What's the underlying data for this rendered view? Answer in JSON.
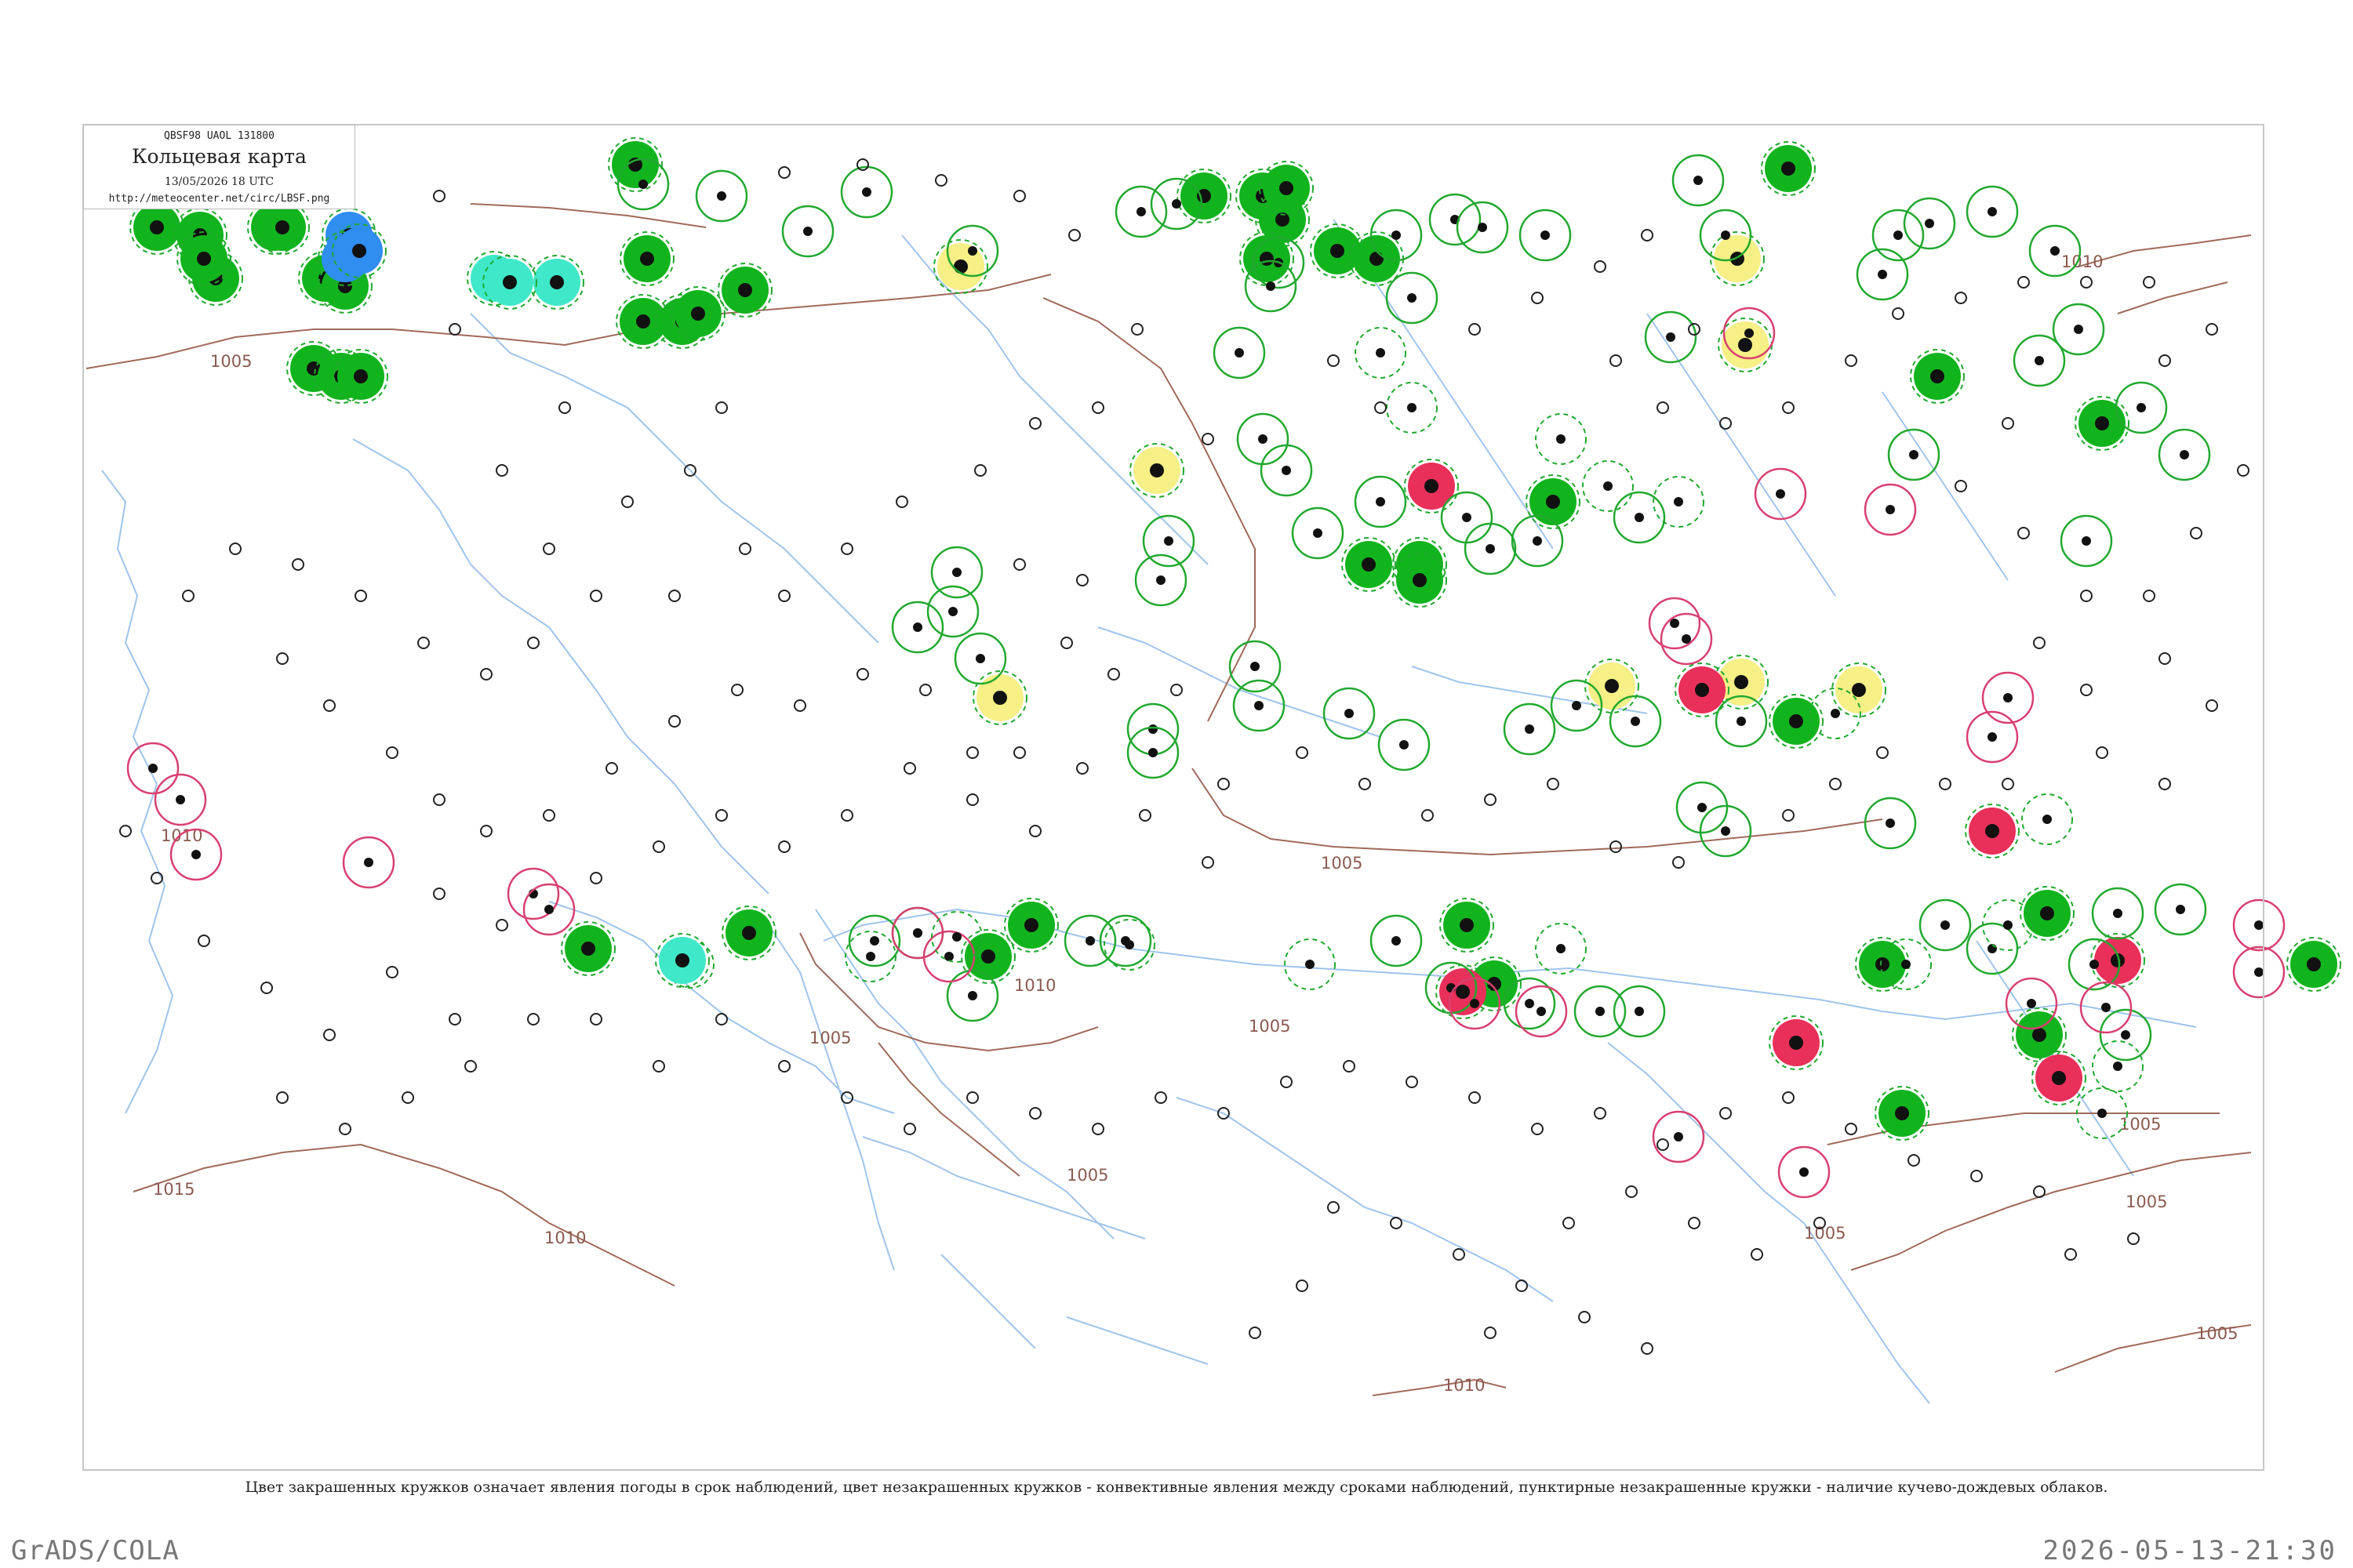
{
  "header": {
    "code": "QBSF98  UAOL  131800",
    "title": "Кольцевая карта",
    "datetime": "13/05/2026 18 UTC",
    "url": "http://meteocenter.net/circ/LBSF.png"
  },
  "caption": "Цвет закрашенных кружков означает явления погоды в срок наблюдений, цвет незакрашенных кружков - конвективные явления между сроками наблюдений, пунктирные незакрашенные кружки - наличие кучево-дождевых облаков.",
  "footer": {
    "left": "GrADS/COLA",
    "right": "2026-05-13-21:30"
  },
  "colors": {
    "isobar": "#a06a5a",
    "water": "#9fc4ec",
    "rain": "#12b41e",
    "drizzle": "#f6f086",
    "thunderstorm": "#e8305a",
    "snow": "#2f8ef0",
    "fog": "#3ee8c8",
    "outline_green": "#22a830",
    "outline_red": "#d84070",
    "frame": "#c8c8c8"
  },
  "isobars": [
    {
      "label": "1005"
    },
    {
      "label": "1010"
    },
    {
      "label": "1010"
    },
    {
      "label": "1005"
    },
    {
      "label": "1005"
    },
    {
      "label": "1010"
    },
    {
      "label": "1015"
    },
    {
      "label": "1010"
    },
    {
      "label": "1005"
    },
    {
      "label": "1005"
    },
    {
      "label": "1005"
    },
    {
      "label": "1010"
    },
    {
      "label": "1005"
    },
    {
      "label": "1005"
    },
    {
      "label": "1005"
    }
  ],
  "station_markers": {
    "filled_rain": 38,
    "filled_snow": 3,
    "filled_fog": 3,
    "filled_drizzle": 6,
    "filled_thunderstorm": 8,
    "open_green": 60,
    "open_red": 14,
    "open_dashed": 30
  }
}
